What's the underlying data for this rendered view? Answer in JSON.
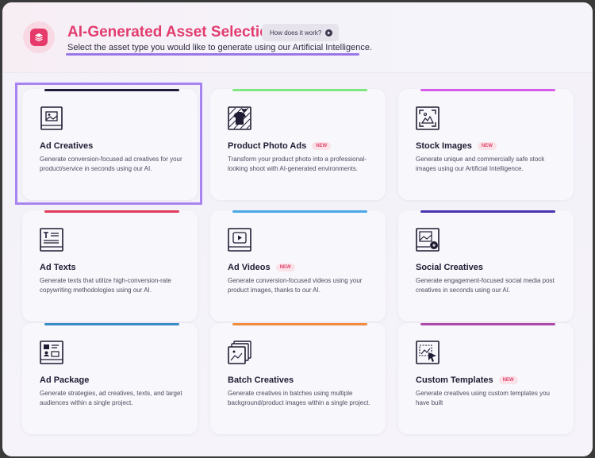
{
  "header": {
    "title": "AI-Generated Asset Selection",
    "how_label": "How does it work?",
    "subtitle": "Select the asset type you would like to generate using our Artificial Intelligence."
  },
  "colors": {
    "title": "#e23c6e",
    "selected_outline": "#a884f0",
    "badge_text": "#e0486f"
  },
  "cards": [
    {
      "name": "Ad Creatives",
      "badge": "",
      "desc": "Generate conversion-focused ad creatives for your product/service in seconds using our AI.",
      "bar_color": "#1e1b3a",
      "icon": "image-frame-icon",
      "selected": true
    },
    {
      "name": "Product Photo Ads",
      "badge": "NEW",
      "desc": "Transform your product photo into a professional-looking shoot with AI-generated environments.",
      "bar_color": "#7ee87e",
      "icon": "product-shirt-icon"
    },
    {
      "name": "Stock Images",
      "badge": "NEW",
      "desc": "Generate unique and commercially safe stock images using our Artificial Intelligence.",
      "bar_color": "#d85ae8",
      "icon": "stock-image-icon"
    },
    {
      "name": "Ad Texts",
      "badge": "",
      "desc": "Generate texts that utilize high-conversion-rate copywriting methodologies using our AI.",
      "bar_color": "#e23c5c",
      "icon": "text-document-icon"
    },
    {
      "name": "Ad Videos",
      "badge": "NEW",
      "desc": "Generate conversion-focused videos using your product images, thanks to our AI.",
      "bar_color": "#4aa8e8",
      "icon": "video-play-icon"
    },
    {
      "name": "Social Creatives",
      "badge": "",
      "desc": "Generate engagement-focused social media post creatives in seconds using our AI.",
      "bar_color": "#4a34b0",
      "icon": "social-image-icon"
    },
    {
      "name": "Ad Package",
      "badge": "",
      "desc": "Generate strategies, ad creatives, texts, and target audiences within a single project.",
      "bar_color": "#3a8cc4",
      "icon": "package-grid-icon"
    },
    {
      "name": "Batch Creatives",
      "badge": "",
      "desc": "Generate creatives in batches using multiple background/product images within a single project.",
      "bar_color": "#f08a3c",
      "icon": "stacked-images-icon"
    },
    {
      "name": "Custom Templates",
      "badge": "NEW",
      "desc": "Generate creatives using custom templates you have built",
      "bar_color": "#b04aa8",
      "icon": "template-cursor-icon"
    }
  ]
}
